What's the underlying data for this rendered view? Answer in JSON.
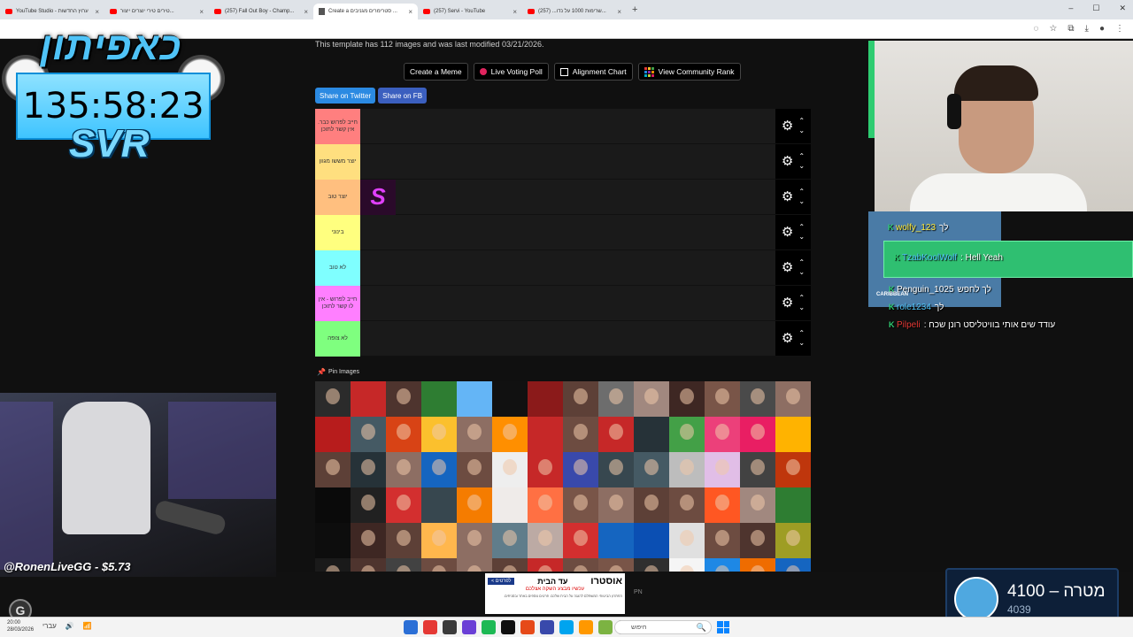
{
  "browser": {
    "tabs": [
      {
        "label": "YouTube Studio - ערוץ החדשות",
        "icon": "youtube-icon",
        "active": false
      },
      {
        "label": "טירים טירי יוצרים ייצור...",
        "icon": "youtube-icon",
        "active": false
      },
      {
        "label": "(257) Fall Out Boy - Champ...",
        "icon": "youtube-icon",
        "active": false
      },
      {
        "label": "Create a סטרימרים מגניבים ...",
        "icon": "doc-icon",
        "active": true
      },
      {
        "label": "(257) Servi - YouTube",
        "icon": "youtube-icon",
        "active": false
      },
      {
        "label": "(257) ...שרימות 1000 על נדו...",
        "icon": "youtube-icon",
        "active": false
      }
    ],
    "new_tab": "+",
    "window_controls": [
      "–",
      "☐",
      "✕"
    ]
  },
  "page": {
    "info": "This template has 112 images and was last modified 03/21/2026.",
    "actions": [
      {
        "label": "Create a Meme"
      },
      {
        "label": "Live Voting Poll"
      },
      {
        "label": "Alignment Chart"
      },
      {
        "label": "View Community Rank"
      }
    ],
    "share": {
      "twitter": "Share on Twitter",
      "fb": "Share on FB"
    },
    "tiers": [
      {
        "label": "חייב לפרוש כבר. אין קשר לתוכן",
        "color": "#ff7f7f"
      },
      {
        "label": "יוצר מששו מגוון",
        "color": "#ffdf7f"
      },
      {
        "label": "יוצר טוב",
        "color": "#ffbf7f"
      },
      {
        "label": "בינוני",
        "color": "#ffff7f"
      },
      {
        "label": "לא טוב",
        "color": "#7fffff"
      },
      {
        "label": "חייב לפרוש - אין לו קשר לתוכן",
        "color": "#ff7fff"
      },
      {
        "label": "לא צופה",
        "color": "#7fff7f"
      }
    ],
    "tier_ctrl": {
      "gear": "⚙",
      "up": "⌃",
      "down": "⌄"
    },
    "placed_item": {
      "letter": "S",
      "tier": 2
    },
    "pin_label": "Pin Images",
    "pin_icon": "📌",
    "pool_colors": [
      "#2b2b2b",
      "#c62828",
      "#4e342e",
      "#2e7d32",
      "#64b5f6",
      "#111111",
      "#8b1a1a",
      "#5d4037",
      "#6d6d6d",
      "#a1887f",
      "#3e2723",
      "#795548",
      "#4a4a4a",
      "#8d6e63",
      "#b71c1c",
      "#455a64",
      "#d84315",
      "#fbc02d",
      "#8d6e63",
      "#ff8f00",
      "#c62828",
      "#6d4c41",
      "#c62828",
      "#263238",
      "#43a047",
      "#ec407a",
      "#e91e63",
      "#ffb300",
      "#5d4037",
      "#263238",
      "#8d6e63",
      "#1565c0",
      "#6d4c41",
      "#eeeeee",
      "#c62828",
      "#3949ab",
      "#37474f",
      "#455a64",
      "#bdbdbd",
      "#e1bee7",
      "#424242",
      "#bf360c",
      "#0a0a0a",
      "#212121",
      "#d32f2f",
      "#37474f",
      "#f57c00",
      "#efebe9",
      "#ff7043",
      "#795548",
      "#8d6e63",
      "#5d4037",
      "#6d4c41",
      "#ff5722",
      "#a1887f",
      "#2e7d32",
      "#0d0d0d",
      "#3e2723",
      "#5d4037",
      "#ffb74d",
      "#8d6e63",
      "#607d8b",
      "#bcaaa4",
      "#d32f2f",
      "#1565c0",
      "#0b4fb3",
      "#e0e0e0",
      "#6d4c41",
      "#4e342e",
      "#9e9d24",
      "#1a1a1a",
      "#4e342e",
      "#424242",
      "#6d4c41",
      "#8d6e63",
      "#5d4037",
      "#c62828",
      "#6d4c41",
      "#795548",
      "#2f2f2f",
      "#f5f5f5",
      "#1e88e5",
      "#ef6c00",
      "#1565c0"
    ],
    "pool_logo_indices": [
      1,
      3,
      4,
      5,
      6,
      14,
      20,
      23,
      27,
      42,
      45,
      47,
      55,
      56,
      64,
      65
    ]
  },
  "ad": {
    "brand": "אוסטרו",
    "headline": "עד הבית",
    "cta": "לפרטים >",
    "sub": "עכשיו מבצע השקה אצלכם",
    "text": "הפתרון הביטוחי המשתלם להגנה על הבית שלכם. פרטים נוספים באתר ובסניפים."
  },
  "overlays": {
    "brand_title": "כאפיתון",
    "timer": "135:58:23",
    "svr": "SVR",
    "donation": "@RonenLiveGG - $5.73",
    "chat": [
      {
        "user": "wolfy_123",
        "msg": "לך",
        "color": "#ffeb3b"
      },
      {
        "user": "TzabKoolWolf",
        "msg": ": Hell Yeah",
        "color": "#4fc3f7"
      },
      {
        "user": "Penguin_1025",
        "msg": "לך לחפש",
        "color": "#ffffff"
      },
      {
        "user": "role1234",
        "msg": "לך",
        "color": "#4fc3f7"
      },
      {
        "user": "Pilpeli",
        "msg": ": עודד שים אותי בוויטליסט רונן שכח",
        "color": "#e53935"
      }
    ],
    "cruise": "CARIBBEAN",
    "pn": "PN",
    "goal": {
      "label": "מטרה",
      "target": "4100",
      "dash": "–",
      "current": "4039"
    },
    "g_logo": "G"
  },
  "taskbar": {
    "clock_time": "20:00",
    "clock_date": "28/03/2026",
    "tray": [
      "עברי",
      "🔊",
      "📶"
    ],
    "search": "חיפוש",
    "search_icon": "🔍",
    "app_colors": [
      "#2b6fd6",
      "#e53935",
      "#3b3b3b",
      "#6a3fd6",
      "#1db954",
      "#0f0f0f",
      "#e64a19",
      "#3949ab",
      "#00a4ef",
      "#ff9800",
      "#7cb342",
      "#424242"
    ]
  }
}
